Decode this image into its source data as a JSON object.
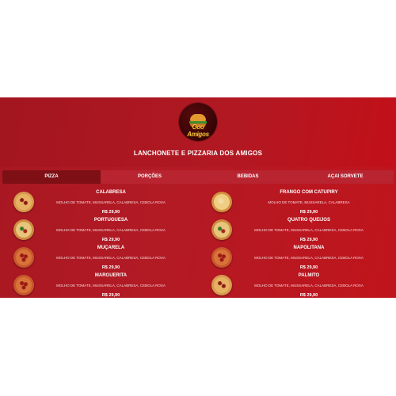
{
  "brand": {
    "logo_text": "Ooo Amigos",
    "title": "LANCHONETE E PIZZARIA DOS AMIGOS"
  },
  "tabs": [
    {
      "label": "PIZZA",
      "active": true
    },
    {
      "label": "PORÇÕES",
      "active": false
    },
    {
      "label": "BEBIDAS",
      "active": false
    },
    {
      "label": "AÇAI SORVETE",
      "active": false
    }
  ],
  "menu": {
    "left": [
      {
        "name": "CALABRESA",
        "desc": "MOLHO DE TOMATE, MUSSARELA, CALABRESA, CEBOLA ROXA",
        "price": "R$ 29,90",
        "icon": "pizza-calabresa-icon"
      },
      {
        "name": "PORTUGUESA",
        "desc": "MOLHO DE TOMATE, MUSSARELA, CALABRESA, CEBOLA ROXA",
        "price": "R$ 29,90",
        "icon": "pizza-portuguesa-icon"
      },
      {
        "name": "MUÇARELA",
        "desc": "MOLHO DE TOMATE, MUSSARELA, CALABRESA, CEBOLA ROXA",
        "price": "R$ 29,90",
        "icon": "pizza-mucarela-icon"
      },
      {
        "name": "MARGUERITA",
        "desc": "MOLHO DE TOMATE, MUSSARELA, CALABRESA, CEBOLA ROXA",
        "price": "R$ 29,90",
        "icon": "pizza-marguerita-icon"
      }
    ],
    "right": [
      {
        "name": "FRANGO COM CATUPIRY",
        "desc": "MOLHO DE TOMATE, MUSSARELA, CALABRESA",
        "price": "R$ 29,90",
        "icon": "pizza-frango-icon"
      },
      {
        "name": "QUATRO QUEIJOS",
        "desc": "MOLHO DE TOMATE, MUSSARELA, CALABRESA, CEBOLA ROXA",
        "price": "R$ 29,90",
        "icon": "pizza-quatro-queijos-icon"
      },
      {
        "name": "NAPOLITANA",
        "desc": "MOLHO DE TOMATE, MUSSARELA, CALABRESA, CEBOLA ROXA",
        "price": "R$ 29,90",
        "icon": "pizza-napolitana-icon"
      },
      {
        "name": "PALMITO",
        "desc": "MOLHO DE TOMATE, MUSSARELA, CALABRESA, CEBOLA ROXA",
        "price": "R$ 29,90",
        "icon": "pizza-palmito-icon"
      }
    ]
  },
  "colors": {
    "background": "#b31a24",
    "active_tab": "#7e0f15",
    "tab_bar": "#b82430",
    "text": "#ffffff"
  }
}
